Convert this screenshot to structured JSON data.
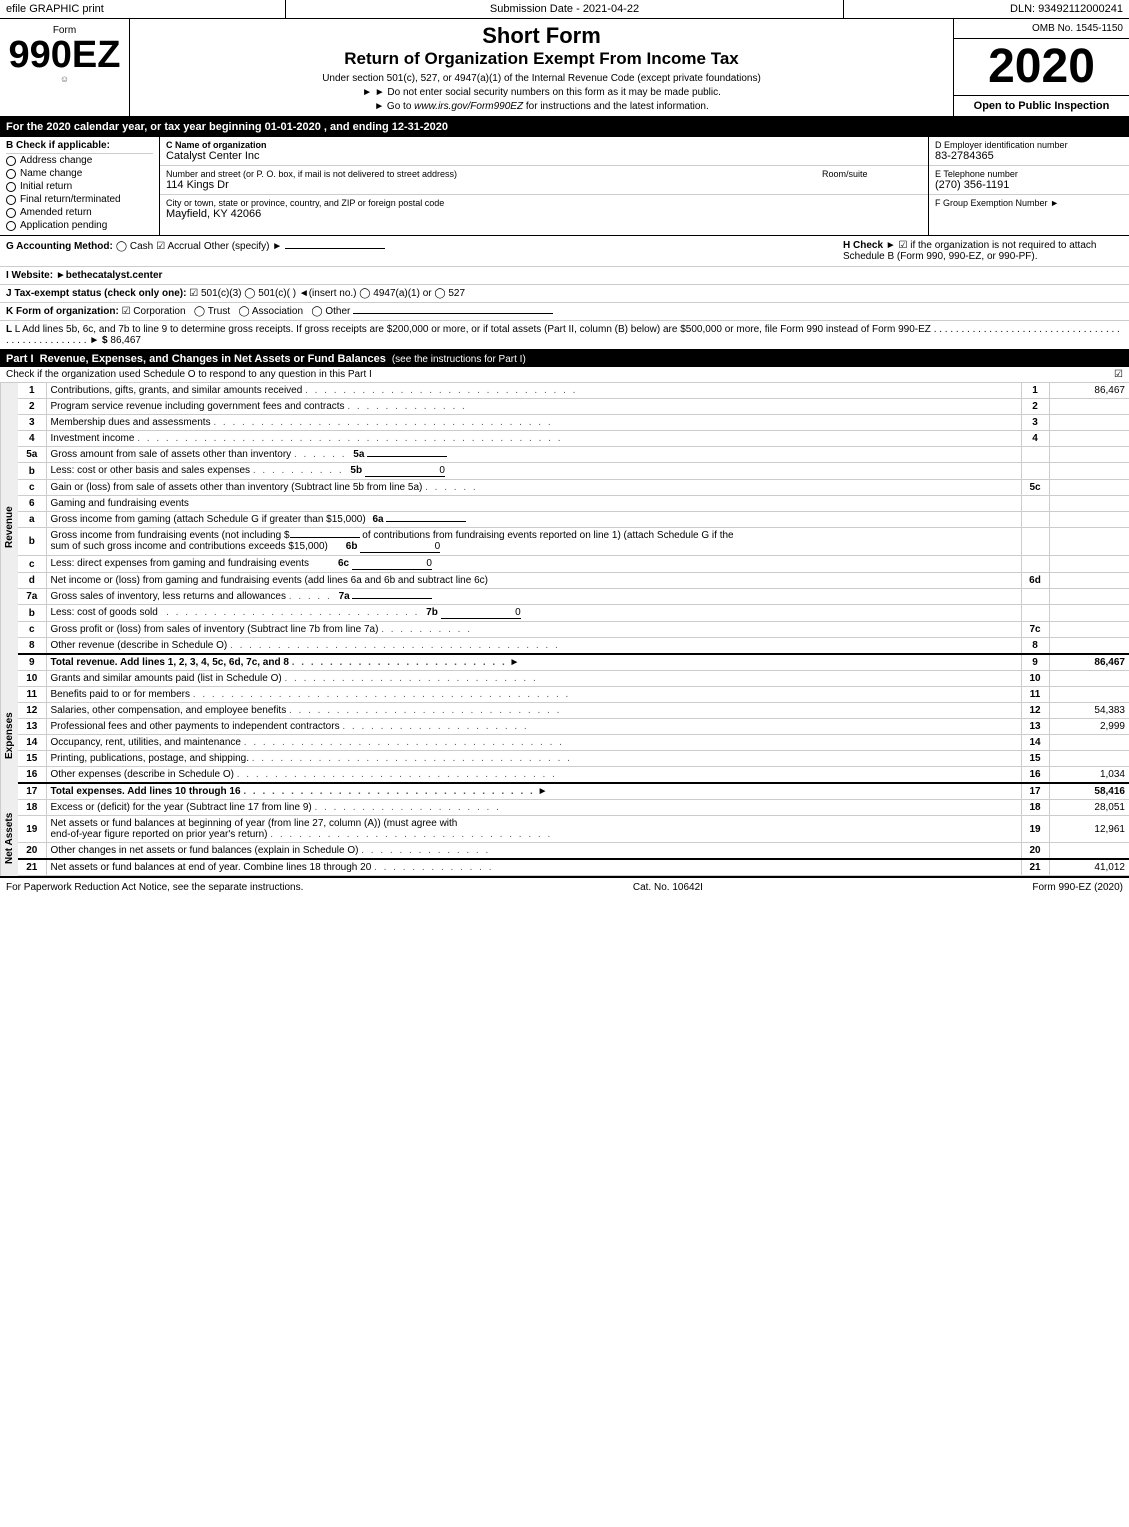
{
  "topBar": {
    "left": "efile GRAPHIC print",
    "mid": "Submission Date - 2021-04-22",
    "right": "DLN: 93492112000241"
  },
  "formHeader": {
    "formLabel": "Form",
    "formNumber": "990EZ",
    "formSub": "☺",
    "shortForm": "Short Form",
    "returnTitle": "Return of Organization Exempt From Income Tax",
    "note1": "Under section 501(c), 527, or 4947(a)(1) of the Internal Revenue Code (except private foundations)",
    "note2": "► Do not enter social security numbers on this form as it may be made public.",
    "note3": "► Go to www.irs.gov/Form990EZ for instructions and the latest information.",
    "ombNo": "OMB No. 1545-1150",
    "year": "2020",
    "openToPublic": "Open to Public Inspection"
  },
  "yearLine": "For the 2020 calendar year, or tax year beginning 01-01-2020 , and ending 12-31-2020",
  "checkApplicable": {
    "label": "B Check if applicable:",
    "items": [
      "Address change",
      "Name change",
      "Initial return",
      "Final return/terminated",
      "Amended return",
      "Application pending"
    ]
  },
  "orgInfo": {
    "cLabel": "C Name of organization",
    "orgName": "Catalyst Center Inc",
    "streetLabel": "Number and street (or P. O. box, if mail is not delivered to street address)",
    "street": "114 Kings Dr",
    "roomLabel": "Room/suite",
    "cityLabel": "City or town, state or province, country, and ZIP or foreign postal code",
    "city": "Mayfield, KY  42066",
    "dLabel": "D Employer identification number",
    "ein": "83-2784365",
    "eLabel": "E Telephone number",
    "phone": "(270) 356-1191",
    "fLabel": "F Group Exemption Number",
    "fArrow": "►"
  },
  "accounting": {
    "gLabel": "G Accounting Method:",
    "cash": "◯ Cash",
    "accrual": "☑ Accrual",
    "other": "Other (specify) ►",
    "hLabel": "H Check ►",
    "hCheck": "☑",
    "hText": "if the organization is not required to attach Schedule B (Form 990, 990-EZ, or 990-PF)."
  },
  "website": {
    "iLabel": "I Website: ►bethecatalyst.center"
  },
  "taxExempt": {
    "jLabel": "J Tax-exempt status (check only one):",
    "options": "☑ 501(c)(3) ◯ 501(c)( ) ◄(insert no.) ◯ 4947(a)(1) or ◯ 527"
  },
  "formOrg": {
    "kLabel": "K Form of organization:",
    "corp": "☑ Corporation",
    "trust": "◯ Trust",
    "assoc": "◯ Association",
    "other": "◯ Other"
  },
  "lLine": {
    "text": "L Add lines 5b, 6c, and 7b to line 9 to determine gross receipts. If gross receipts are $200,000 or more, or if total assets (Part II, column (B) below) are $500,000 or more, file Form 990 instead of Form 990-EZ",
    "dots": ". . . . . . . . . . . . . . . . . . . . . . . . . . . . . . . . . . . . . . . . . . . . . . . . .",
    "arrow": "► $",
    "value": "86,467"
  },
  "part1": {
    "header": "Part I",
    "title": "Revenue, Expenses, and Changes in Net Assets or Fund Balances",
    "subtitle": "(see the instructions for Part I)",
    "checkLine": "Check if the organization used Schedule O to respond to any question in this Part I",
    "checkBox": "☑",
    "lines": [
      {
        "num": "1",
        "desc": "Contributions, gifts, grants, and similar amounts received",
        "val": "86,467",
        "bold": false
      },
      {
        "num": "2",
        "desc": "Program service revenue including government fees and contracts",
        "val": "",
        "bold": false
      },
      {
        "num": "3",
        "desc": "Membership dues and assessments",
        "val": "",
        "bold": false
      },
      {
        "num": "4",
        "desc": "Investment income",
        "val": "",
        "bold": false
      },
      {
        "num": "5a",
        "desc": "Gross amount from sale of assets other than inventory",
        "mid": "5a",
        "midVal": "",
        "val": "",
        "bold": false
      },
      {
        "num": "b",
        "desc": "Less: cost or other basis and sales expenses",
        "mid": "5b",
        "midVal": "0",
        "val": "",
        "bold": false
      },
      {
        "num": "c",
        "desc": "Gain or (loss) from sale of assets other than inventory (Subtract line 5b from line 5a)",
        "val": "",
        "lineNum": "5c",
        "bold": false
      },
      {
        "num": "6",
        "desc": "Gaming and fundraising events",
        "val": "",
        "bold": false
      },
      {
        "num": "a",
        "desc": "Gross income from gaming (attach Schedule G if greater than $15,000)",
        "mid": "6a",
        "midVal": "",
        "val": "",
        "bold": false
      },
      {
        "num": "b",
        "desc": "Gross income from fundraising events (not including $_____ of contributions from fundraising events reported on line 1) (attach Schedule G if the sum of such gross income and contributions exceeds $15,000)",
        "mid": "6b",
        "midVal": "0",
        "val": "",
        "bold": false
      },
      {
        "num": "c",
        "desc": "Less: direct expenses from gaming and fundraising events",
        "mid": "6c",
        "midVal": "0",
        "val": "",
        "bold": false
      },
      {
        "num": "d",
        "desc": "Net income or (loss) from gaming and fundraising events (add lines 6a and 6b and subtract line 6c)",
        "val": "",
        "lineNum": "6d",
        "bold": false
      },
      {
        "num": "7a",
        "desc": "Gross sales of inventory, less returns and allowances",
        "mid": "7a",
        "midVal": "",
        "val": "",
        "bold": false
      },
      {
        "num": "b",
        "desc": "Less: cost of goods sold",
        "mid": "7b",
        "midVal": "0",
        "val": "",
        "bold": false
      },
      {
        "num": "c",
        "desc": "Gross profit or (loss) from sales of inventory (Subtract line 7b from line 7a)",
        "val": "",
        "lineNum": "7c",
        "bold": false
      },
      {
        "num": "8",
        "desc": "Other revenue (describe in Schedule O)",
        "val": "",
        "bold": false
      },
      {
        "num": "9",
        "desc": "Total revenue. Add lines 1, 2, 3, 4, 5c, 6d, 7c, and 8",
        "arrow": "►",
        "val": "86,467",
        "bold": true
      }
    ]
  },
  "expenses": {
    "lines": [
      {
        "num": "10",
        "desc": "Grants and similar amounts paid (list in Schedule O)",
        "val": "",
        "bold": false
      },
      {
        "num": "11",
        "desc": "Benefits paid to or for members",
        "val": "",
        "bold": false
      },
      {
        "num": "12",
        "desc": "Salaries, other compensation, and employee benefits",
        "val": "54,383",
        "bold": false
      },
      {
        "num": "13",
        "desc": "Professional fees and other payments to independent contractors",
        "val": "2,999",
        "bold": false
      },
      {
        "num": "14",
        "desc": "Occupancy, rent, utilities, and maintenance",
        "val": "",
        "bold": false
      },
      {
        "num": "15",
        "desc": "Printing, publications, postage, and shipping.",
        "val": "",
        "bold": false
      },
      {
        "num": "16",
        "desc": "Other expenses (describe in Schedule O)",
        "val": "1,034",
        "bold": false
      },
      {
        "num": "17",
        "desc": "Total expenses. Add lines 10 through 16",
        "arrow": "►",
        "val": "58,416",
        "bold": true
      }
    ]
  },
  "netAssets": {
    "lines": [
      {
        "num": "18",
        "desc": "Excess or (deficit) for the year (Subtract line 17 from line 9)",
        "val": "28,051",
        "bold": false
      },
      {
        "num": "19",
        "desc": "Net assets or fund balances at beginning of year (from line 27, column (A)) (must agree with end-of-year figure reported on prior year's return)",
        "val": "12,961",
        "lineNum": "19",
        "bold": false
      },
      {
        "num": "20",
        "desc": "Other changes in net assets or fund balances (explain in Schedule O)",
        "val": "",
        "bold": false
      },
      {
        "num": "21",
        "desc": "Net assets or fund balances at end of year. Combine lines 18 through 20",
        "val": "41,012",
        "bold": false
      }
    ]
  },
  "footer": {
    "left": "For Paperwork Reduction Act Notice, see the separate instructions.",
    "mid": "Cat. No. 10642I",
    "right": "Form 990-EZ (2020)"
  }
}
